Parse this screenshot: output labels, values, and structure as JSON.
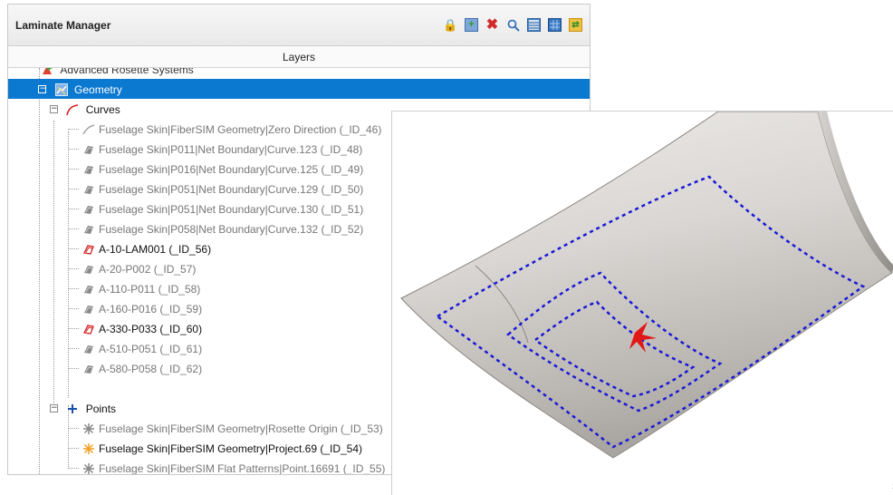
{
  "panel": {
    "title": "Laminate Manager",
    "layers_header": "Layers",
    "toolbar": [
      {
        "name": "lock-icon",
        "glyph": "🔒"
      },
      {
        "name": "add-icon",
        "glyph": "+"
      },
      {
        "name": "delete-icon",
        "glyph": "✖"
      },
      {
        "name": "search-icon",
        "glyph": "🔍"
      },
      {
        "name": "table-icon",
        "glyph": ""
      },
      {
        "name": "grid-icon",
        "glyph": ""
      },
      {
        "name": "export-icon",
        "glyph": "⇄"
      }
    ]
  },
  "tree": {
    "cut_item": "Advanced Rosette Systems",
    "geometry": "Geometry",
    "curves": "Curves",
    "curve_items": [
      {
        "label": "Fuselage Skin|FiberSIM Geometry|Zero Direction (_ID_46)",
        "icon": "curve-line-icon",
        "style": "dim"
      },
      {
        "label": "Fuselage Skin|P011|Net Boundary|Curve.123 (_ID_48)",
        "icon": "ply-curve-icon",
        "style": "dim"
      },
      {
        "label": "Fuselage Skin|P016|Net Boundary|Curve.125 (_ID_49)",
        "icon": "ply-curve-icon",
        "style": "dim"
      },
      {
        "label": "Fuselage Skin|P051|Net Boundary|Curve.129 (_ID_50)",
        "icon": "ply-curve-icon",
        "style": "dim"
      },
      {
        "label": "Fuselage Skin|P051|Net Boundary|Curve.130 (_ID_51)",
        "icon": "ply-curve-icon",
        "style": "dim"
      },
      {
        "label": "Fuselage Skin|P058|Net Boundary|Curve.132 (_ID_52)",
        "icon": "ply-curve-icon",
        "style": "dim"
      },
      {
        "label": "A-10-LAM001 (_ID_56)",
        "icon": "red-curve-icon",
        "style": "dark"
      },
      {
        "label": "A-20-P002 (_ID_57)",
        "icon": "ply-curve-icon",
        "style": "dim"
      },
      {
        "label": "A-110-P011 (_ID_58)",
        "icon": "ply-curve-icon",
        "style": "dim"
      },
      {
        "label": "A-160-P016 (_ID_59)",
        "icon": "ply-curve-icon",
        "style": "dim"
      },
      {
        "label": "A-330-P033 (_ID_60)",
        "icon": "red-curve-icon",
        "style": "dark"
      },
      {
        "label": "A-510-P051 (_ID_61)",
        "icon": "ply-curve-icon",
        "style": "dim"
      },
      {
        "label": "A-580-P058 (_ID_62)",
        "icon": "ply-curve-icon",
        "style": "dim"
      }
    ],
    "points": "Points",
    "point_items": [
      {
        "label": "Fuselage Skin|FiberSIM Geometry|Rosette Origin (_ID_53)",
        "icon": "grey-star-icon",
        "style": "dim"
      },
      {
        "label": "Fuselage Skin|FiberSIM Geometry|Project.69 (_ID_54)",
        "icon": "orange-star-icon",
        "style": "dark"
      },
      {
        "label": "Fuselage Skin|FiberSIM Flat Patterns|Point.16691 (_ID_55)",
        "icon": "grey-star-icon",
        "style": "dim"
      }
    ]
  },
  "colors": {
    "selection": "#0b79d0",
    "boundary_curves": "#1a1ad6",
    "rosette_marker": "#e01818"
  }
}
